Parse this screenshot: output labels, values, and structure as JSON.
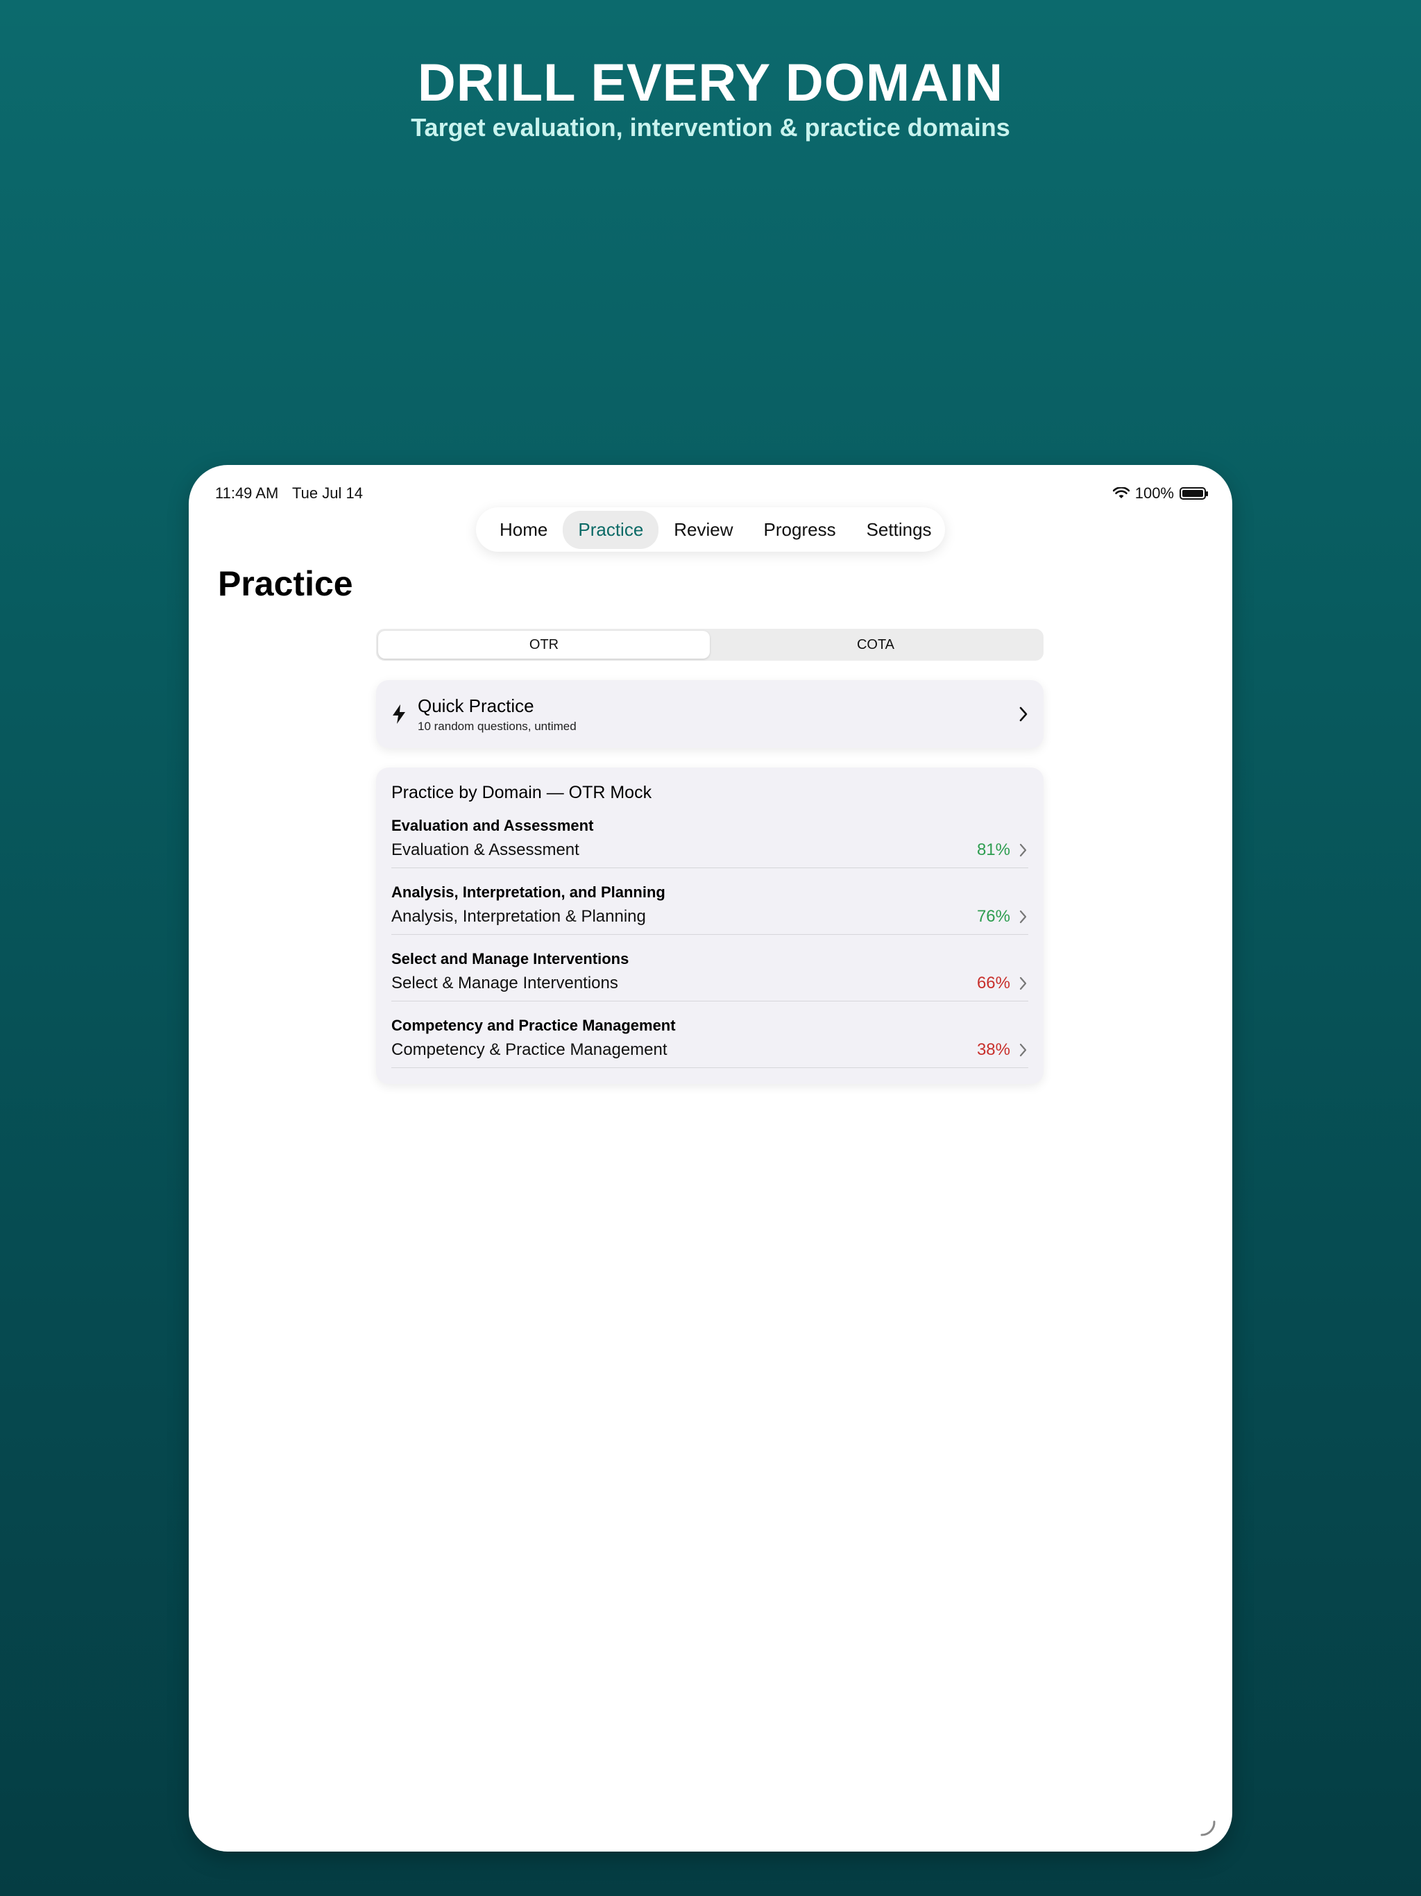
{
  "hero": {
    "title": "DRILL EVERY DOMAIN",
    "subtitle": "Target evaluation, intervention & practice domains"
  },
  "status_bar": {
    "time": "11:49 AM",
    "date": "Tue Jul 14",
    "battery": "100%",
    "icons": [
      "wifi-icon",
      "battery-icon"
    ]
  },
  "tabs": [
    {
      "label": "Home"
    },
    {
      "label": "Practice",
      "active": true
    },
    {
      "label": "Review"
    },
    {
      "label": "Progress"
    },
    {
      "label": "Settings"
    }
  ],
  "page": {
    "title": "Practice"
  },
  "segment": {
    "options": [
      "OTR",
      "COTA"
    ],
    "selected": "OTR"
  },
  "quick_practice": {
    "title": "Quick Practice",
    "subtitle": "10 random questions, untimed",
    "icon": "bolt-icon"
  },
  "domains": {
    "heading": "Practice by Domain — OTR Mock",
    "items": [
      {
        "category": "Evaluation and Assessment",
        "name": "Evaluation & Assessment",
        "percent": "81%",
        "status_color": "#2e9d50"
      },
      {
        "category": "Analysis, Interpretation, and Planning",
        "name": "Analysis, Interpretation & Planning",
        "percent": "76%",
        "status_color": "#2e9d50"
      },
      {
        "category": "Select and Manage Interventions",
        "name": "Select & Manage Interventions",
        "percent": "66%",
        "status_color": "#c8302c"
      },
      {
        "category": "Competency and Practice Management",
        "name": "Competency & Practice Management",
        "percent": "38%",
        "status_color": "#c8302c"
      }
    ]
  },
  "colors": {
    "accent": "#0b6a66",
    "good": "#2e9d50",
    "bad": "#c8302c"
  }
}
